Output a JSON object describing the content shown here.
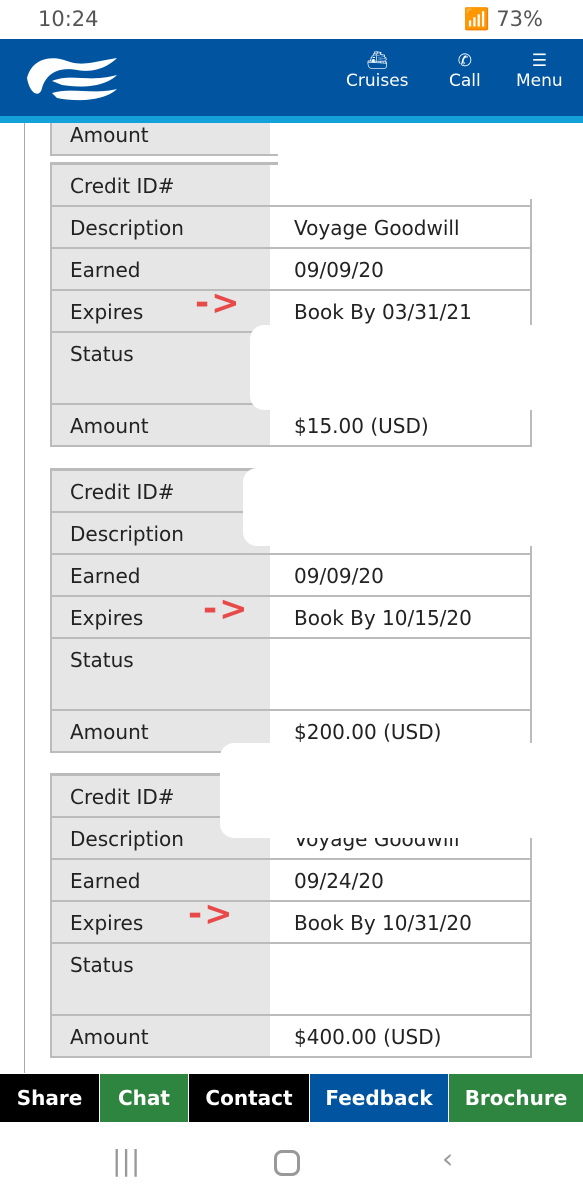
{
  "status_bar": {
    "time": "10:24",
    "battery": "73%"
  },
  "header": {
    "nav": [
      {
        "label": "Cruises",
        "icon": "ship-icon"
      },
      {
        "label": "Call",
        "icon": "phone-icon"
      },
      {
        "label": "Menu",
        "icon": "hamburger-icon"
      }
    ],
    "brand_color": "#0054a0"
  },
  "partial_top_label": "Amount",
  "labels": {
    "id": "Credit ID#",
    "desc": "Description",
    "earned": "Earned",
    "expires": "Expires",
    "status": "Status",
    "amount": "Amount"
  },
  "credits": [
    {
      "description": "Voyage Goodwill",
      "earned": "09/09/20",
      "expires": "Book By 03/31/21",
      "amount": "$15.00 (USD)"
    },
    {
      "description": "",
      "earned": "09/09/20",
      "expires": "Book By 10/15/20",
      "amount": "$200.00 (USD)"
    },
    {
      "description": "Voyage Goodwill",
      "earned": "09/24/20",
      "expires": "Book By 10/31/20",
      "amount": "$400.00 (USD)"
    }
  ],
  "annotation_arrow": "->",
  "bottom_bar": [
    {
      "label": "Share",
      "color": "#000000"
    },
    {
      "label": "Chat",
      "color": "#2e8540"
    },
    {
      "label": "Contact",
      "color": "#000000"
    },
    {
      "label": "Feedback",
      "color": "#0054a0"
    },
    {
      "label": "Brochure",
      "color": "#2e8540"
    }
  ]
}
